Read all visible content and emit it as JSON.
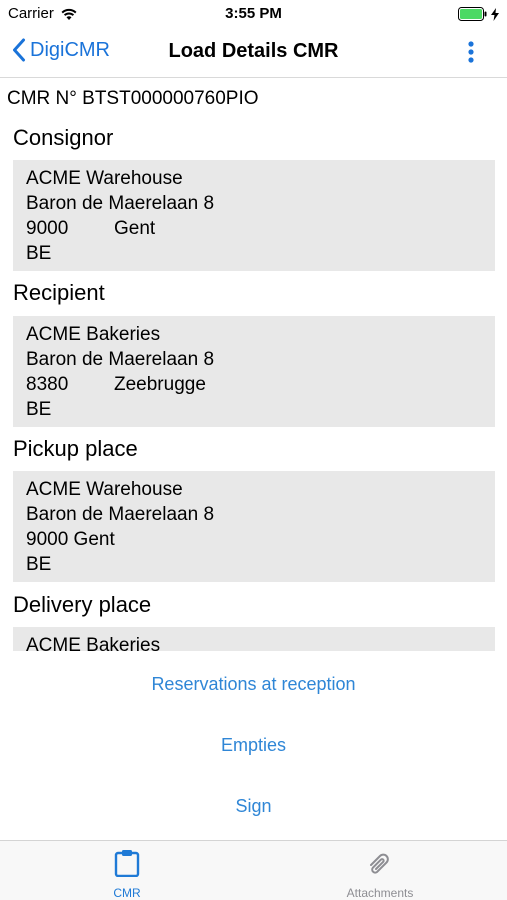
{
  "status_bar": {
    "carrier": "Carrier",
    "time": "3:55 PM"
  },
  "nav": {
    "back_label": "DigiCMR",
    "title": "Load Details CMR"
  },
  "cmr_number": "CMR N° BTST000000760PIO",
  "sections": {
    "consignor": {
      "title": "Consignor",
      "name": "ACME Warehouse",
      "street": "Baron de Maerelaan 8",
      "postal_code": "9000",
      "city": "Gent",
      "country": "BE"
    },
    "recipient": {
      "title": "Recipient",
      "name": "ACME Bakeries",
      "street": "Baron de Maerelaan 8",
      "postal_code": "8380",
      "city": "Zeebrugge",
      "country": "BE"
    },
    "pickup": {
      "title": "Pickup place",
      "name": "ACME Warehouse",
      "street": "Baron de Maerelaan 8",
      "postal_city": "9000 Gent",
      "country": "BE"
    },
    "delivery": {
      "title": "Delivery place",
      "name": "ACME Bakeries"
    }
  },
  "actions": {
    "reservations": "Reservations at reception",
    "empties": "Empties",
    "sign": "Sign"
  },
  "tabs": {
    "cmr": {
      "label": "CMR",
      "icon": "clipboard-icon",
      "active": true
    },
    "attachments": {
      "label": "Attachments",
      "icon": "paperclip-icon",
      "active": false
    }
  },
  "colors": {
    "accent": "#1a73d9",
    "link": "#2f86d6",
    "box": "#e8e8e8",
    "inactive": "#8e8e93"
  }
}
